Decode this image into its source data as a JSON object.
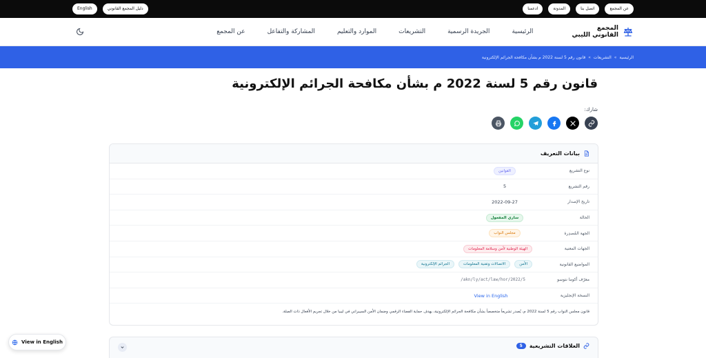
{
  "topbar": {
    "right_links": [
      "عن المجمع",
      "اتصل بنا",
      "المدونة",
      "ادعمنا"
    ],
    "left_links": [
      "دليل المجمع القانوني",
      "English"
    ]
  },
  "header": {
    "logo_line1": "المجمع",
    "logo_line2": "القانوني الليبي",
    "nav": [
      "الرئيسية",
      "الجريدة الرسمية",
      "التشريعات",
      "الموارد والتعليم",
      "المشاركة والتفاعل",
      "عن المجمع"
    ]
  },
  "breadcrumb": {
    "items": [
      "الرئيسية",
      "التشريعات",
      "قانون رقم 5 لسنة 2022 م بشأن مكافحة الجرائم الإلكترونية"
    ],
    "separator": "»"
  },
  "page": {
    "title": "قانون رقم 5 لسنة 2022 م بشأن مكافحة الجرائم الإلكترونية",
    "share_label": "شارك:"
  },
  "share": {
    "icons": [
      "link-icon",
      "x-icon",
      "facebook-icon",
      "telegram-icon",
      "whatsapp-icon",
      "print-icon"
    ],
    "colors": [
      "#374151",
      "#000000",
      "#1877f2",
      "#229ed9",
      "#25d366",
      "#4b5563"
    ]
  },
  "metadata": {
    "title": "بيانات التعريف",
    "rows": {
      "type_label": "نوع التشريع",
      "type_value": "القوانين",
      "number_label": "رقم التشريع",
      "number_value": "5",
      "date_label": "تاريخ الإصدار",
      "date_value": "2022-09-27",
      "status_label": "الحالة",
      "status_value": "ساري المفعول",
      "issuer_label": "الجهة المُصدِرة",
      "issuer_value": "مجلس النواب",
      "concerned_label": "الجهات المعنية",
      "concerned_value": "الهيئة الوطنية لأمن وسلامة المعلومات",
      "topics_label": "المواضيع القانونية",
      "topics": [
        "الأمن",
        "الاتصالات وتقنية المعلومات",
        "الجرائم الإلكترونية"
      ],
      "akn_label": "معرّف أكوما نتوسو",
      "akn_value": "/akn/ly/act/law/hor/2022/5",
      "english_label": "النسخة الإنجليزية",
      "english_value": "View in English"
    },
    "summary": "قانون مجلس النواب رقم 5 لسنة 2022 م، يُصدر تشريعاً متخصصاً بشأن مكافحة الجرائم الإلكترونية، يهدف حماية الفضاء الرقمي وضمان الأمن السيبراني في ليبيا من خلال تجريم الأفعال ذات الصلة."
  },
  "relations": {
    "title": "العلاقات التشريعية",
    "count": "5"
  },
  "fab": {
    "label": "View in English"
  }
}
